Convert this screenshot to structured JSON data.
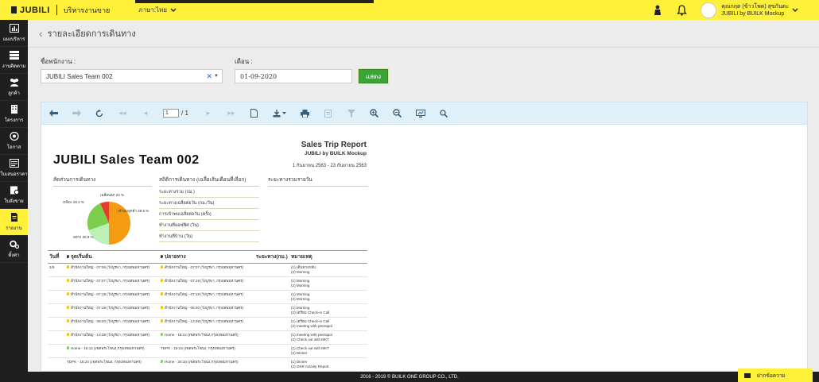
{
  "topbar": {
    "brand": "JUBILI",
    "menu": "บริหารงานขาย",
    "language": "ภาษา:ไทย",
    "user_name": "คุณกฤต (ข้าวโพด) สุขกันตะ",
    "user_company": "JUBILI by BUILK Mockup"
  },
  "sidebar": {
    "items": [
      {
        "label": "แผงบริหาร",
        "icon": "bar-chart-icon"
      },
      {
        "label": "งานติดตาม",
        "icon": "tasks-icon"
      },
      {
        "label": "ลูกค้า",
        "icon": "customers-icon"
      },
      {
        "label": "โครงการ",
        "icon": "building-icon"
      },
      {
        "label": "โอกาส",
        "icon": "target-icon"
      },
      {
        "label": "ใบเสนอราคา",
        "icon": "quotation-icon"
      },
      {
        "label": "ใบสั่งขาย",
        "icon": "sales-order-icon"
      },
      {
        "label": "รายงาน",
        "icon": "report-icon"
      },
      {
        "label": "ตั้งค่า",
        "icon": "settings-icon"
      }
    ],
    "active_index": 7
  },
  "header": {
    "title": "รายละเอียดการเดินทาง"
  },
  "filters": {
    "employee_label": "ชื่อพนักงาน :",
    "employee_value": "JUBILI Sales Team 002",
    "month_label": "เดือน :",
    "month_value": "01-09-2020",
    "show_button": "แสดง"
  },
  "viewer": {
    "page_current": "1",
    "page_total": "/ 1"
  },
  "report": {
    "company": "JUBILI Sales Team 002",
    "title": "Sales Trip Report",
    "subtitle": "JUBILI by BUILK Mockup",
    "range": "1 กันยายน 2563 - 23 กันยายน 2563",
    "sec_ratio": "สัดส่วนการเดินทาง",
    "sec_stats": "สถิติการเดินทาง (เฉลี่ยเส้นเดือนที่เลือก)",
    "sec_daily": "ระยะทางรวมรายวัน",
    "stats": [
      "ระยะทางรวม (กม.)",
      "ระยะทางเฉลี่ยต่อวัน (กม./วัน)",
      "การเข้าพบเฉลี่ยต่อวัน (ครั้ง)",
      "ทำงานที่ออฟฟิศ (วัน)",
      "ทำงานที่บ้าน (วัน)"
    ],
    "pie_labels": {
      "a": "เฉลี่ยนอก 24 %",
      "b": "Office 28.2 %",
      "c": "เข้าพบลูกค้า 28.5 %",
      "d": "WFH 30.9 %"
    },
    "columns": [
      "วันที่",
      "จุดเริ่มต้น",
      "ปลายทาง",
      "ระยะทาง(กม.)",
      "หมายเหตุ"
    ],
    "rows": [
      {
        "date": "1/9",
        "start": "สำนักงานใหญ่ - 07:06 (วังบูรพา, กรุงเทพมหานคร)",
        "end": "สำนักงานใหญ่ - 07:07 (วังบูรพา, กรุงเทพมหานคร)",
        "dist": "",
        "n1": "(1) เดินทางกลับ",
        "n2": "(2) Morning",
        "sg": false,
        "eg": false
      },
      {
        "date": "",
        "start": "สำนักงานใหญ่ - 07:07 (วังบูรพา, กรุงเทพมหานคร)",
        "end": "สำนักงานใหญ่ - 07:19 (วังบูรพา, กรุงเทพมหานคร)",
        "dist": "",
        "n1": "(1) Morning",
        "n2": "(2) Morning",
        "sg": false,
        "eg": false
      },
      {
        "date": "",
        "start": "สำนักงานใหญ่ - 07:19 (วังบูรพา, กรุงเทพมหานคร)",
        "end": "สำนักงานใหญ่ - 07:19 (วังบูรพา, กรุงเทพมหานคร)",
        "dist": "",
        "n1": "(1) Morning",
        "n2": "(2) Morning",
        "sg": false,
        "eg": false
      },
      {
        "date": "",
        "start": "สำนักงานใหญ่ - 07:19 (วังบูรพา, กรุงเทพมหานคร)",
        "end": "สำนักงานใหญ่ - 08:20 (วังบูรพา, กรุงเทพมหานคร)",
        "dist": "",
        "n1": "(1) Morning",
        "n2": "(2) เตรียม Check-in Call",
        "sg": false,
        "eg": false
      },
      {
        "date": "",
        "start": "สำนักงานใหญ่ - 08:20 (วังบูรพา, กรุงเทพมหานคร)",
        "end": "สำนักงานใหญ่ - 13:38 (วังบูรพา, กรุงเทพมหานคร)",
        "dist": "",
        "n1": "(1) เตรียม Check-in Call",
        "n2": "(2) meeting with peerapol",
        "sg": false,
        "eg": false
      },
      {
        "date": "",
        "start": "สำนักงานใหญ่ - 13:38 (วังบูรพา, กรุงเทพมหานคร)",
        "end": "Home - 18:12 (เขตพระโขนง,กรุงเทพมหานคร)",
        "dist": "",
        "n1": "(1) meeting with peerapol",
        "n2": "(2) Check out with MKT",
        "sg": false,
        "eg": true
      },
      {
        "date": "",
        "start": "Home - 18:12 (เขตพระโขนง,กรุงเทพมหานคร)",
        "end": "TDPK - 18:24 (เขตพระโขนง, กรุงเทพมหานคร)",
        "dist": "",
        "n1": "(1) Check out with MKT",
        "n2": "(2) Dinner",
        "sg": true,
        "eg": null
      },
      {
        "date": "",
        "start": "TDPK - 18:24 (เขตพระโขนง, กรุงเทพมหานคร)",
        "end": "Home - 20:15 (เขตพระโขนง,กรุงเทพมหานคร)",
        "dist": "",
        "n1": "(1) Dinner",
        "n2": "(2) OKR Activity Report",
        "sg": null,
        "eg": true
      }
    ]
  },
  "footer": {
    "copyright": "2016 - 2019 © BUILK ONE GROUP CO., LTD.",
    "message_button": "ฝากข้อความ"
  },
  "colors": {
    "brand_yellow": "#fff03a",
    "sidebar_dark": "#1f1f1f",
    "show_button_green": "#3aa536"
  }
}
